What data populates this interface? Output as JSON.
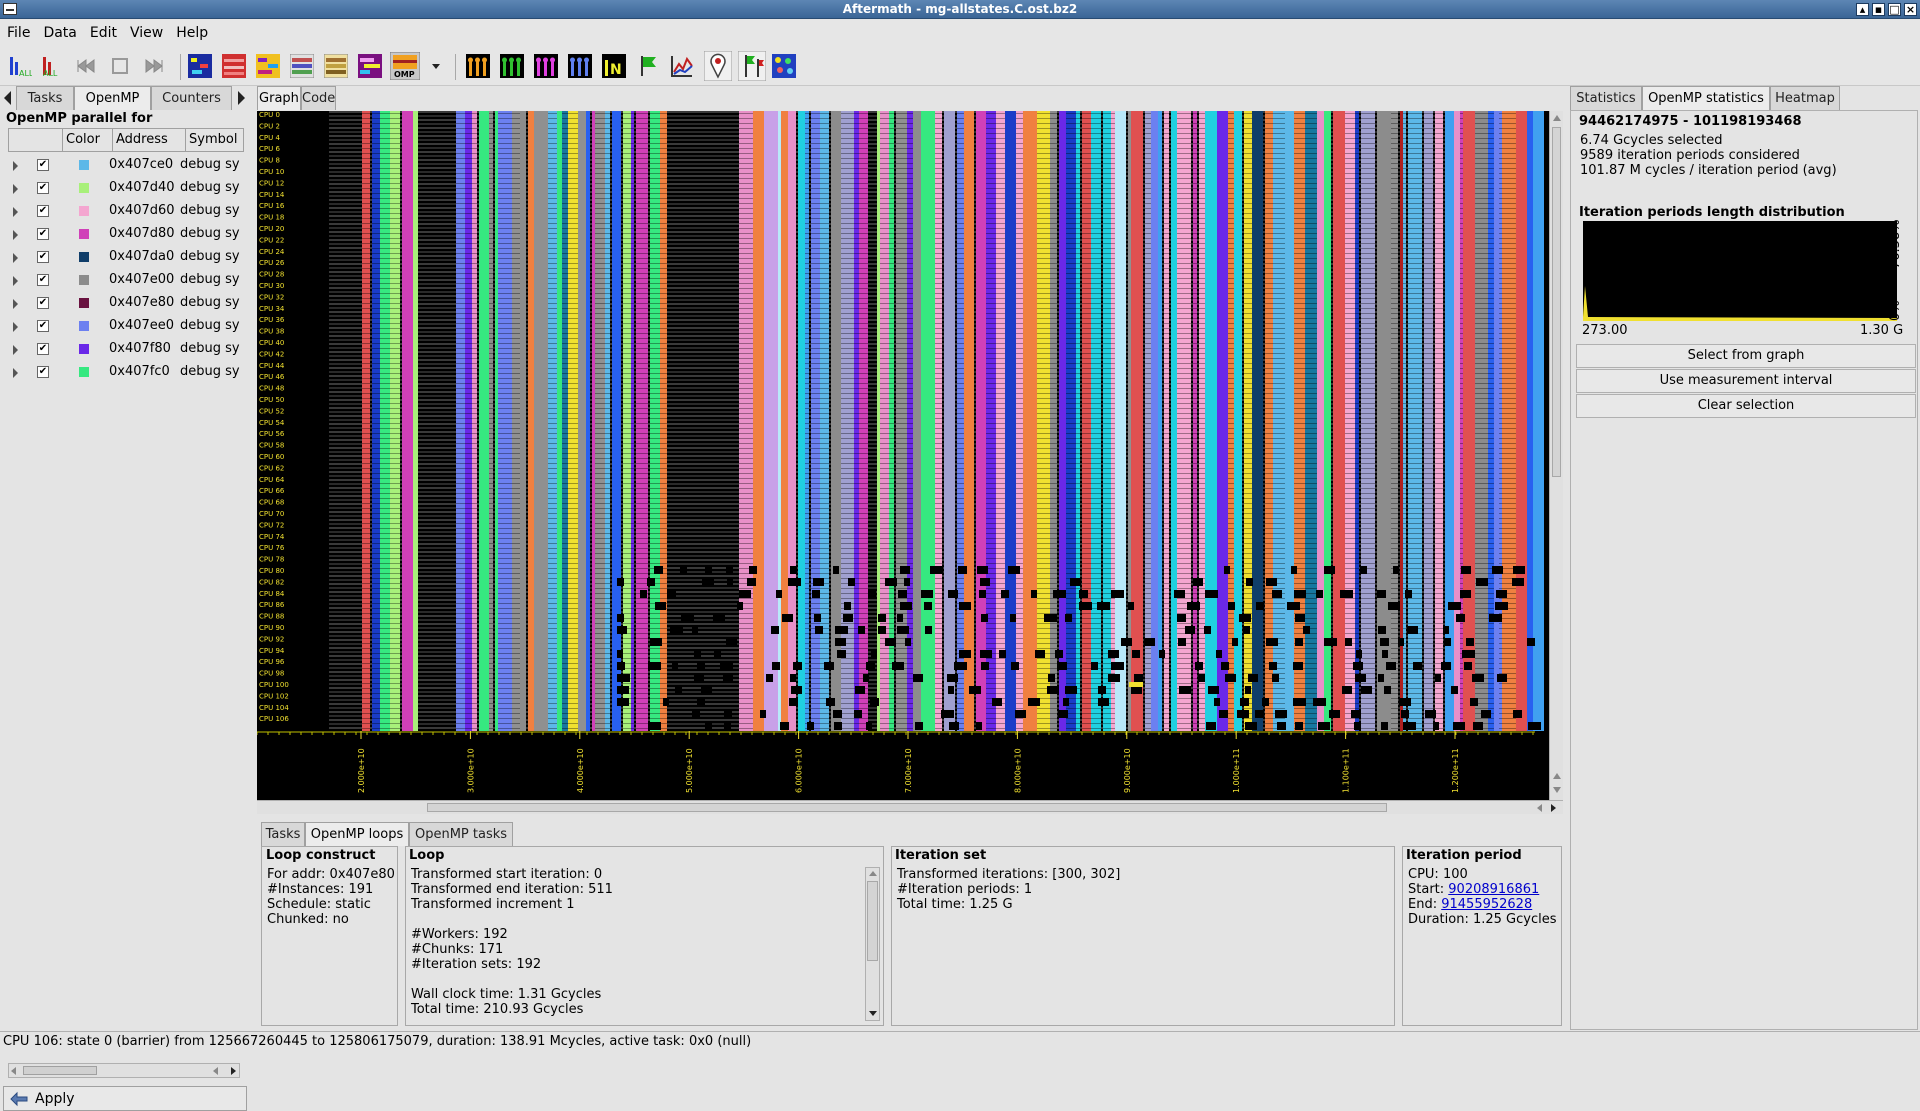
{
  "window": {
    "title": "Aftermath - mg-allstates.C.ost.bz2"
  },
  "menu": [
    "File",
    "Data",
    "Edit",
    "View",
    "Help"
  ],
  "toolbar": {
    "icons": [
      "filter-all-icon",
      "filter-all-red-icon",
      "first-icon",
      "back-icon",
      "last-icon",
      "state-mode-icon",
      "heatmap-mode-icon",
      "type-mode-icon",
      "numa-read-icon",
      "numa-write-icon",
      "task-mode-icon",
      "omp-mode-icon",
      "dropdown-icon",
      "single-events-icon",
      "comm-icon",
      "counters-icon",
      "steal-icon",
      "task-length-icon",
      "annotations-icon",
      "derived-counter-icon",
      "measure-icon",
      "interval-icon",
      "color-grid-icon"
    ]
  },
  "left": {
    "tabs": [
      "Tasks",
      "OpenMP",
      "Counters"
    ],
    "active_tab": 1,
    "title": "OpenMP parallel for",
    "columns": [
      "",
      "Color",
      "Address",
      "Symbol"
    ],
    "rows": [
      {
        "color": "#5cb8e8",
        "address": "0x407ce0",
        "symbol": "debug sy"
      },
      {
        "color": "#a8f07a",
        "address": "0x407d40",
        "symbol": "debug sy"
      },
      {
        "color": "#f4a6d0",
        "address": "0x407d60",
        "symbol": "debug sy"
      },
      {
        "color": "#d040b8",
        "address": "0x407d80",
        "symbol": "debug sy"
      },
      {
        "color": "#103e6a",
        "address": "0x407da0",
        "symbol": "debug sy"
      },
      {
        "color": "#8c8c8c",
        "address": "0x407e00",
        "symbol": "debug sy"
      },
      {
        "color": "#6a1240",
        "address": "0x407e80",
        "symbol": "debug sy"
      },
      {
        "color": "#6c80f0",
        "address": "0x407ee0",
        "symbol": "debug sy"
      },
      {
        "color": "#6a28e8",
        "address": "0x407f80",
        "symbol": "debug sy"
      },
      {
        "color": "#36e880",
        "address": "0x407fc0",
        "symbol": "debug sy"
      }
    ],
    "apply": "Apply"
  },
  "center": {
    "tabs": [
      "Graph",
      "Code"
    ],
    "active_tab": 0,
    "cpu_labels": [
      "CPU 0",
      "CPU 2",
      "CPU 4",
      "CPU 6",
      "CPU 8",
      "CPU 10",
      "CPU 12",
      "CPU 14",
      "CPU 16",
      "CPU 18",
      "CPU 20",
      "CPU 22",
      "CPU 24",
      "CPU 26",
      "CPU 28",
      "CPU 30",
      "CPU 32",
      "CPU 34",
      "CPU 36",
      "CPU 38",
      "CPU 40",
      "CPU 42",
      "CPU 44",
      "CPU 46",
      "CPU 48",
      "CPU 50",
      "CPU 52",
      "CPU 54",
      "CPU 56",
      "CPU 58",
      "CPU 60",
      "CPU 62",
      "CPU 64",
      "CPU 66",
      "CPU 68",
      "CPU 70",
      "CPU 72",
      "CPU 74",
      "CPU 76",
      "CPU 78",
      "CPU 80",
      "CPU 82",
      "CPU 84",
      "CPU 86",
      "CPU 88",
      "CPU 90",
      "CPU 92",
      "CPU 94",
      "CPU 96",
      "CPU 98",
      "CPU 100",
      "CPU 102",
      "CPU 104",
      "CPU 106"
    ],
    "axis_ticks": [
      "2.000e+10",
      "3.000e+10",
      "4.000e+10",
      "5.000e+10",
      "6.000e+10",
      "7.000e+10",
      "8.000e+10",
      "9.000e+10",
      "1.000e+11",
      "1.100e+11",
      "1.200e+11"
    ],
    "stripe_palette": [
      "#5cb8e8",
      "#a8f07a",
      "#f4a6d0",
      "#d040b8",
      "#103e6a",
      "#8c8c8c",
      "#6a1240",
      "#6c80f0",
      "#6a28e8",
      "#36e880",
      "#f0e030",
      "#20d0e0",
      "#1a3cc8",
      "#e05050",
      "#a0a0d0",
      "#c8a0e8",
      "#40a0f0",
      "#b02020",
      "#f08040",
      "#2860f0",
      "#909090",
      "#e890c8",
      "#1878a0",
      "#b8e8f8"
    ]
  },
  "bottom": {
    "tabs": [
      "Tasks",
      "OpenMP loops",
      "OpenMP tasks"
    ],
    "active_tab": 1,
    "loop_construct": {
      "title": "Loop construct",
      "lines": [
        "For addr: 0x407e80",
        "#Instances: 191",
        "Schedule: static",
        "Chunked: no"
      ]
    },
    "loop": {
      "title": "Loop",
      "lines": [
        "Transformed start iteration: 0",
        "Transformed end iteration: 511",
        "Transformed increment 1",
        "",
        "#Workers: 192",
        "#Chunks: 171",
        "#Iteration sets: 192",
        "",
        "Wall clock time: 1.31 Gcycles",
        "Total time: 210.93 Gcycles"
      ]
    },
    "iteration_set": {
      "title": "Iteration set",
      "lines": [
        "Transformed iterations: [300, 302]",
        "#Iteration periods: 1",
        "Total time: 1.25 G"
      ]
    },
    "iteration_period": {
      "title": "Iteration period",
      "cpu": "CPU: 100",
      "start_label": "Start:",
      "start": "90208916861",
      "end_label": "End:",
      "end": "91455952628",
      "duration": "Duration: 1.25 Gcycles"
    }
  },
  "right": {
    "tabs": [
      "Statistics",
      "OpenMP statistics",
      "Heatmap"
    ],
    "active_tab": 1,
    "range": "94462174975 - 101198193468",
    "selected": "6.74 Gcycles selected",
    "considered": "9589 iteration periods considered",
    "avg": "101.87 M cycles / iteration period (avg)",
    "hist_title": "Iteration periods length distribution",
    "hist_xmin": "273.00",
    "hist_xmax": "1.30 G",
    "hist_ymax": "76.38%",
    "hist_ymin": "0%",
    "buttons": [
      "Select from graph",
      "Use measurement interval",
      "Clear selection"
    ]
  },
  "status": "CPU 106: state 0 (barrier) from 125667260445 to 125806175079, duration: 138.91 Mcycles, active task: 0x0 (null)"
}
